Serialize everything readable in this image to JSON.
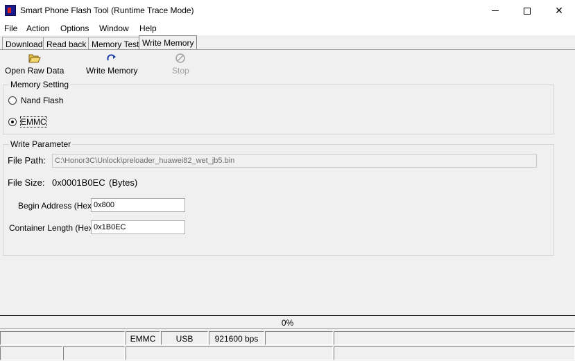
{
  "window": {
    "title": "Smart Phone Flash Tool (Runtime Trace Mode)",
    "icons": {
      "minimize": "minimize-icon",
      "maximize": "maximize-icon",
      "close": "close-icon"
    },
    "close_glyph": "✕"
  },
  "menu": [
    "File",
    "Action",
    "Options",
    "Window",
    "Help"
  ],
  "tabs": [
    "Download",
    "Read back",
    "Memory Test",
    "Write Memory"
  ],
  "active_tab": "Write Memory",
  "toolbar": {
    "open_raw_data": "Open Raw Data",
    "write_memory": "Write Memory",
    "stop": "Stop"
  },
  "memory_setting": {
    "title": "Memory Setting",
    "options": [
      "Nand Flash",
      "EMMC"
    ],
    "selected": "EMMC"
  },
  "write_parameter": {
    "title": "Write Parameter",
    "file_path_label": "File Path:",
    "file_path_value": "C:\\Honor3C\\Unlock\\preloader_huawei82_wet_jb5.bin",
    "file_size_label": "File Size:",
    "file_size_value": "0x0001B0EC",
    "file_size_unit": "(Bytes)",
    "begin_address_label": "Begin Address (Hex) :",
    "begin_address_value": "0x800",
    "container_length_label": "Container Length (Hex) :",
    "container_length_value": "0x1B0EC"
  },
  "progress": {
    "text": "0%",
    "value": 0
  },
  "status": {
    "memory": "EMMC",
    "connection": "USB",
    "baud": "921600 bps"
  },
  "colors": {
    "window_bg": "#f0f0f0",
    "titlebar_bg": "#ffffff",
    "border": "#a0a0a0"
  }
}
